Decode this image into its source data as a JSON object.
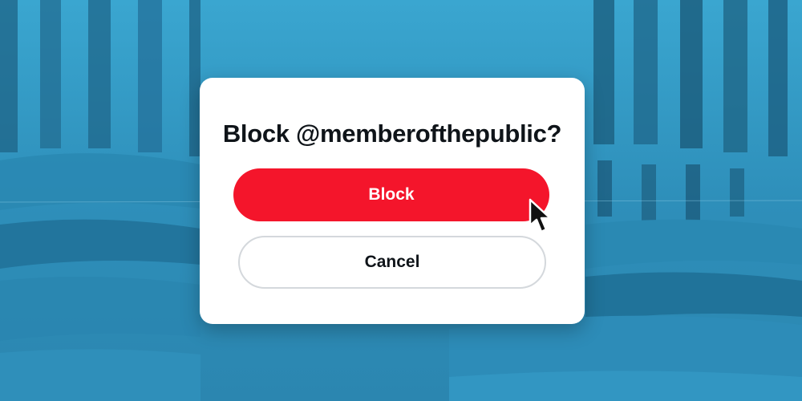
{
  "dialog": {
    "title": "Block @memberofthepublic?",
    "confirm_label": "Block",
    "cancel_label": "Cancel"
  },
  "colors": {
    "background": "#2f95bf",
    "confirm_button": "#f4152b",
    "dialog": "#ffffff"
  },
  "icons": {
    "cursor": "arrow-cursor-icon"
  }
}
